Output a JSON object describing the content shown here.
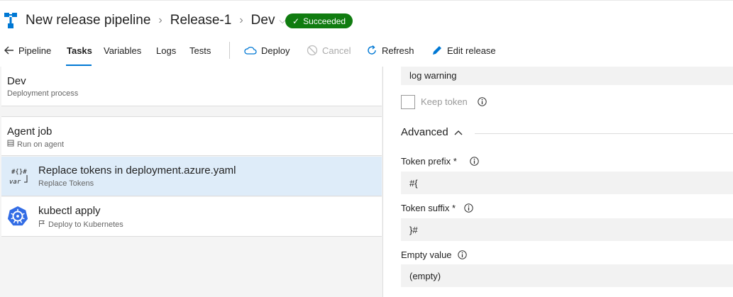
{
  "header": {
    "crumbs": [
      "New release pipeline",
      "Release-1",
      "Dev"
    ],
    "status_badge": "Succeeded",
    "status_color": "#107c10"
  },
  "toolbar": {
    "back_label": "Pipeline",
    "tabs": [
      "Tasks",
      "Variables",
      "Logs",
      "Tests"
    ],
    "active_tab": "Tasks",
    "actions": {
      "deploy": "Deploy",
      "cancel": "Cancel",
      "refresh": "Refresh",
      "edit_release": "Edit release"
    }
  },
  "left_panel": {
    "stage": {
      "title": "Dev",
      "subtitle": "Deployment process"
    },
    "job": {
      "title": "Agent job",
      "subtitle": "Run on agent"
    },
    "tasks": [
      {
        "title": "Replace tokens in deployment.azure.yaml",
        "subtitle": "Replace Tokens",
        "icon": "replace-tokens-icon",
        "icon_text": [
          "#{}#",
          "var"
        ]
      },
      {
        "title": "kubectl apply",
        "subtitle": "Deploy to Kubernetes",
        "icon": "kubernetes-icon"
      }
    ]
  },
  "right_panel": {
    "log_value": "log warning",
    "keep_token_label": "Keep token",
    "advanced_label": "Advanced",
    "token_prefix": {
      "label": "Token prefix *",
      "value": "#{"
    },
    "token_suffix": {
      "label": "Token suffix *",
      "value": "}#"
    },
    "empty_value": {
      "label": "Empty value",
      "value": "(empty)"
    }
  },
  "colors": {
    "accent": "#0078d4",
    "selected_row": "#deecf9"
  }
}
